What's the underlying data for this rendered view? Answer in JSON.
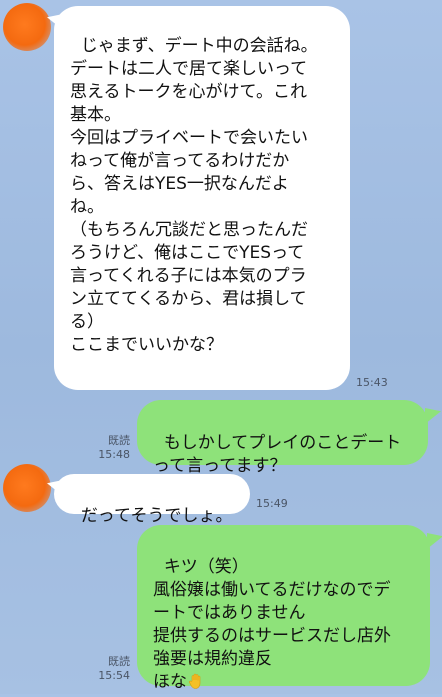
{
  "messages": [
    {
      "side": "in",
      "text": "じゃまず、デート中の会話ね。\nデートは二人で居て楽しいって\n思えるトークを心がけて。これ\n基本。\n今回はプライベートで会いたい\nねって俺が言ってるわけだか\nら、答えはYES一択なんだよ\nね。\n（もちろん冗談だと思ったんだ\nろうけど、俺はここでYESって\n言ってくれる子には本気のプラ\nン立ててくるから、君は損して\nる）\nここまでいいかな？",
      "time": "15:43"
    },
    {
      "side": "out",
      "text": "もしかしてプレイのことデート\nって言ってます？",
      "read": "既読",
      "time": "15:48"
    },
    {
      "side": "in",
      "text": "だってそうでしょ。",
      "time": "15:49"
    },
    {
      "side": "out",
      "text": "キツ（笑）\n風俗嬢は働いてるだけなのでデ\nートではありません\n提供するのはサービスだし店外\n強要は規約違反\nほな",
      "emoji": "raised-hand-emoji",
      "read": "既読",
      "time": "15:54"
    }
  ],
  "colors": {
    "background": "#a9c3e6",
    "incoming_bubble": "#ffffff",
    "outgoing_bubble": "#8ee27a",
    "avatar": "#f46a10"
  }
}
